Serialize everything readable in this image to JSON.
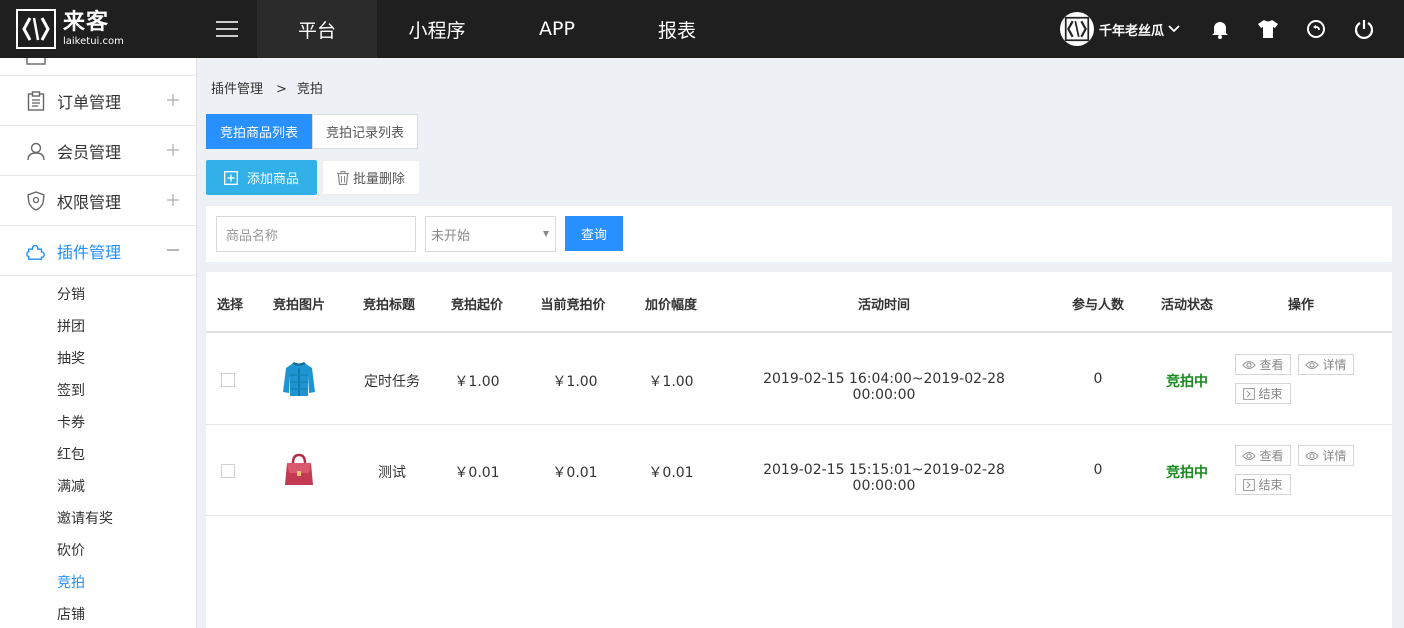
{
  "logo": {
    "cn": "来客",
    "en": "laiketui.com"
  },
  "nav": [
    {
      "label": "平台",
      "active": true
    },
    {
      "label": "小程序",
      "active": false
    },
    {
      "label": "APP",
      "active": false
    },
    {
      "label": "报表",
      "active": false
    }
  ],
  "user": {
    "name": "千年老丝瓜"
  },
  "sidebar": {
    "menus": [
      {
        "label": "订单管理",
        "icon": "clipboard-icon"
      },
      {
        "label": "会员管理",
        "icon": "user-icon"
      },
      {
        "label": "权限管理",
        "icon": "shield-icon"
      },
      {
        "label": "插件管理",
        "icon": "puzzle-icon"
      }
    ],
    "submenus": [
      "分销",
      "拼团",
      "抽奖",
      "签到",
      "卡券",
      "红包",
      "满减",
      "邀请有奖",
      "砍价",
      "竞拍",
      "店铺"
    ],
    "active_submenu": "竞拍"
  },
  "breadcrumb": {
    "parent": "插件管理",
    "sep": ">",
    "current": "竞拍"
  },
  "tabs": [
    {
      "label": "竞拍商品列表",
      "active": true
    },
    {
      "label": "竞拍记录列表",
      "active": false
    }
  ],
  "buttons": {
    "add": "添加商品",
    "batch_delete": "批量删除",
    "query": "查询"
  },
  "filter": {
    "name_placeholder": "商品名称",
    "status_selected": "未开始"
  },
  "table": {
    "headers": [
      "选择",
      "竞拍图片",
      "竞拍标题",
      "竞拍起价",
      "当前竞拍价",
      "加价幅度",
      "活动时间",
      "参与人数",
      "活动状态",
      "操作"
    ],
    "rows": [
      {
        "title": "定时任务",
        "start_price": "￥1.00",
        "current_price": "￥1.00",
        "increment": "￥1.00",
        "time": "2019-02-15 16:04:00~2019-02-28 00:00:00",
        "participants": "0",
        "status": "竞拍中",
        "image": "jacket"
      },
      {
        "title": "测试",
        "start_price": "￥0.01",
        "current_price": "￥0.01",
        "increment": "￥0.01",
        "time": "2019-02-15 15:15:01~2019-02-28 00:00:00",
        "participants": "0",
        "status": "竞拍中",
        "image": "handbag"
      }
    ],
    "actions": {
      "view": "查看",
      "detail": "详情",
      "end": "结束"
    }
  },
  "colors": {
    "primary": "#2890ff",
    "add_button": "#32b1e8",
    "status_green": "#1a8a20",
    "topbar": "#1f1f1f"
  }
}
